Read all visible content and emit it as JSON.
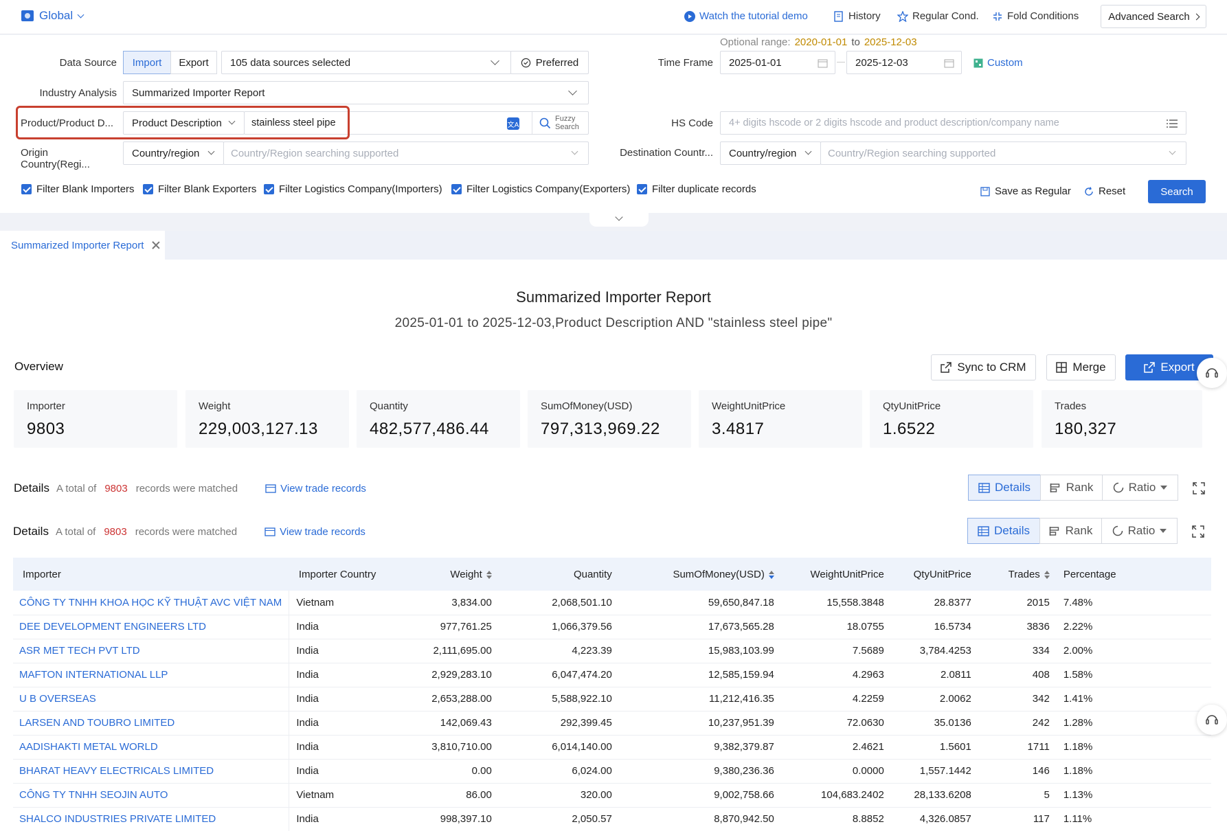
{
  "topbar": {
    "scope": "Global",
    "watch_demo": "Watch the tutorial demo",
    "history": "History",
    "regular_cond": "Regular Cond.",
    "fold_conditions": "Fold Conditions",
    "advanced_search": "Advanced Search"
  },
  "filters": {
    "data_source_label": "Data Source",
    "import_label": "Import",
    "export_label": "Export",
    "sources_selected": "105 data sources selected",
    "preferred_label": "Preferred",
    "optional_range_label": "Optional range:",
    "optional_range_start": "2020-01-01",
    "optional_range_to": "to",
    "optional_range_end": "2025-12-03",
    "time_frame_label": "Time Frame",
    "date_start": "2025-01-01",
    "date_end": "2025-12-03",
    "custom_label": "Custom",
    "industry_label": "Industry Analysis",
    "industry_value": "Summarized Importer Report",
    "product_label": "Product/Product D...",
    "product_field": "Product Description",
    "product_query": "stainless steel pipe",
    "fuzzy_line1": "Fuzzy",
    "fuzzy_line2": "Search",
    "hs_label": "HS Code",
    "hs_placeholder": "4+ digits hscode or 2 digits hscode and product description/company name",
    "origin_label": "Origin Country(Regi...",
    "origin_type": "Country/region",
    "origin_placeholder": "Country/Region searching supported",
    "dest_label": "Destination Countr...",
    "dest_type": "Country/region",
    "dest_placeholder": "Country/Region searching supported",
    "checks": [
      "Filter Blank Importers",
      "Filter Blank Exporters",
      "Filter Logistics Company(Importers)",
      "Filter Logistics Company(Exporters)",
      "Filter duplicate records"
    ],
    "save_regular": "Save as Regular",
    "reset": "Reset",
    "search": "Search"
  },
  "tab": {
    "label": "Summarized Importer Report"
  },
  "report": {
    "title": "Summarized Importer Report",
    "subtitle": "2025-01-01 to 2025-12-03,Product Description AND \"stainless steel pipe\"",
    "overview_label": "Overview",
    "sync_crm": "Sync to CRM",
    "merge": "Merge",
    "export": "Export",
    "cards": [
      {
        "k": "Importer",
        "v": "9803"
      },
      {
        "k": "Weight",
        "v": "229,003,127.13"
      },
      {
        "k": "Quantity",
        "v": "482,577,486.44"
      },
      {
        "k": "SumOfMoney(USD)",
        "v": "797,313,969.22"
      },
      {
        "k": "WeightUnitPrice",
        "v": "3.4817"
      },
      {
        "k": "QtyUnitPrice",
        "v": "1.6522"
      },
      {
        "k": "Trades",
        "v": "180,327"
      }
    ],
    "details_label": "Details",
    "total_prefix": "A total of",
    "total_count": "9803",
    "total_suffix": "records were matched",
    "view_trade": "View trade records",
    "toggle_details": "Details",
    "toggle_rank": "Rank",
    "toggle_ratio": "Ratio"
  },
  "table": {
    "headers": [
      "Importer",
      "Importer Country",
      "Weight",
      "Quantity",
      "SumOfMoney(USD)",
      "WeightUnitPrice",
      "QtyUnitPrice",
      "Trades",
      "Percentage"
    ],
    "rows": [
      [
        "CÔNG TY TNHH KHOA HỌC KỸ THUẬT AVC VIỆT NAM",
        "Vietnam",
        "3,834.00",
        "2,068,501.10",
        "59,650,847.18",
        "15,558.3848",
        "28.8377",
        "2015",
        "7.48%"
      ],
      [
        "DEE DEVELOPMENT ENGINEERS LTD",
        "India",
        "977,761.25",
        "1,066,379.56",
        "17,673,565.28",
        "18.0755",
        "16.5734",
        "3836",
        "2.22%"
      ],
      [
        "ASR MET TECH PVT LTD",
        "India",
        "2,111,695.00",
        "4,223.39",
        "15,983,103.99",
        "7.5689",
        "3,784.4253",
        "334",
        "2.00%"
      ],
      [
        "MAFTON INTERNATIONAL LLP",
        "India",
        "2,929,283.10",
        "6,047,474.20",
        "12,585,159.94",
        "4.2963",
        "2.0811",
        "408",
        "1.58%"
      ],
      [
        "U B OVERSEAS",
        "India",
        "2,653,288.00",
        "5,588,922.10",
        "11,212,416.35",
        "4.2259",
        "2.0062",
        "342",
        "1.41%"
      ],
      [
        "LARSEN AND TOUBRO LIMITED",
        "India",
        "142,069.43",
        "292,399.45",
        "10,237,951.39",
        "72.0630",
        "35.0136",
        "242",
        "1.28%"
      ],
      [
        "AADISHAKTI METAL WORLD",
        "India",
        "3,810,710.00",
        "6,014,140.00",
        "9,382,379.87",
        "2.4621",
        "1.5601",
        "1711",
        "1.18%"
      ],
      [
        "BHARAT HEAVY ELECTRICALS LIMITED",
        "India",
        "0.00",
        "6,024.00",
        "9,380,236.36",
        "0.0000",
        "1,557.1442",
        "146",
        "1.18%"
      ],
      [
        "CÔNG TY TNHH SEOJIN AUTO",
        "Vietnam",
        "86.00",
        "320.00",
        "9,002,758.66",
        "104,683.2402",
        "28,133.6208",
        "5",
        "1.13%"
      ],
      [
        "SHALCO INDUSTRIES PRIVATE LIMITED",
        "India",
        "998,397.10",
        "2,050.57",
        "8,870,942.50",
        "8.8852",
        "4,326.0857",
        "117",
        "1.11%"
      ]
    ]
  }
}
